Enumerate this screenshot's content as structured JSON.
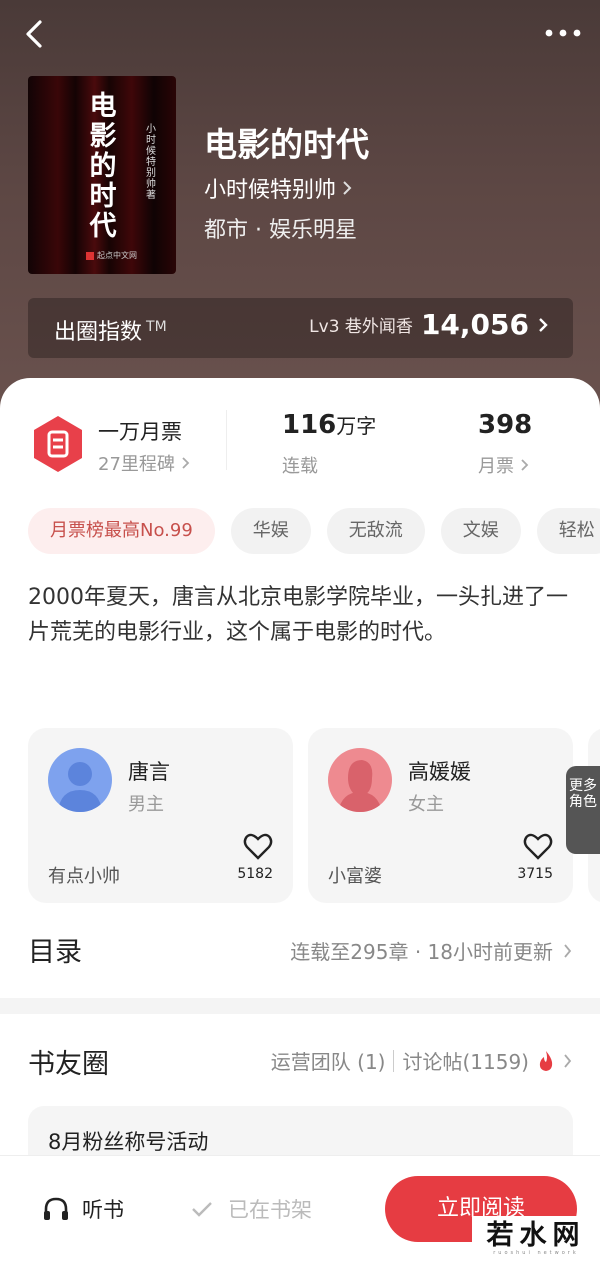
{
  "header": {
    "back_icon": "chevron-left-icon",
    "more_icon": "more-dots-icon"
  },
  "book": {
    "cover_title": "电影的时代",
    "cover_author": "小时候特别帅 著",
    "cover_publisher": "起点中文网",
    "title": "电影的时代",
    "author": "小时候特别帅",
    "genre": "都市 · 娱乐明星"
  },
  "index": {
    "label": "出圈指数",
    "tm": "TM",
    "level": "Lv3 巷外闻香",
    "value": "14,056"
  },
  "stats": {
    "ticket_title": "一万月票",
    "ticket_sub": "27里程碑",
    "words_value": "116",
    "words_unit": "万字",
    "words_label": "连载",
    "monthly_value": "398",
    "monthly_label": "月票"
  },
  "tags": [
    "月票榜最高No.99",
    "华娱",
    "无敌流",
    "文娱",
    "轻松"
  ],
  "synopsis": "2000年夏天，唐言从北京电影学院毕业，一头扎进了一片荒芜的电影行业，这个属于电影的时代。",
  "characters": [
    {
      "name": "唐言",
      "role": "男主",
      "tag": "有点小帅",
      "likes": "5182",
      "color": "#7ea2ee"
    },
    {
      "name": "高媛媛",
      "role": "女主",
      "tag": "小富婆",
      "likes": "3715",
      "color": "#ee8a90"
    }
  ],
  "more_roles": "更多角色",
  "toc": {
    "title": "目录",
    "info": "连载至295章 · 18小时前更新"
  },
  "circle": {
    "title": "书友圈",
    "team": "运营团队 (1)",
    "posts": "讨论帖(1159)",
    "activity": "8月粉丝称号活动"
  },
  "bottom": {
    "listen": "听书",
    "shelf": "已在书架",
    "read": "立即阅读"
  },
  "watermark": {
    "text": "若水网",
    "sub": "ruoshui network"
  },
  "colors": {
    "accent": "#e63c42",
    "hero": "#5d4744"
  }
}
